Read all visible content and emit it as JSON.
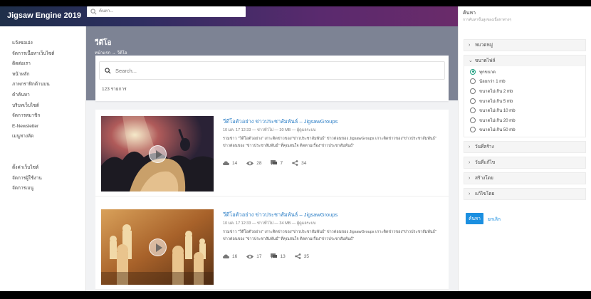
{
  "app": {
    "brand": "Jigsaw Engine 2019"
  },
  "topsearch": {
    "placeholder": "ค้นหา..."
  },
  "sidebar": {
    "section1": "",
    "items1": [
      "แจ้งขอเอ่ง",
      "จัดการเนื้อหาเว็บไซต์",
      "ติดต่อเรา",
      "หน้าหลัก",
      "ภาพกราฟิกด้านบน",
      "คำค้นหา",
      "บริบทเว็บไซต์",
      "จัดการสมาชิก",
      "E-Newsletter",
      "เมนูทางลัด"
    ],
    "section2": "",
    "items2": [
      "ตั้งค่าเว็บไซต์",
      "จัดการผู้ใช้งาน",
      "จัดการเมนู"
    ]
  },
  "header": {
    "title": "วีดีโอ",
    "breadcrumb": "หน้าแรก → วีดีโอ"
  },
  "search": {
    "placeholder": "Search...",
    "result_count": "123 รายการ"
  },
  "items": [
    {
      "title": "วีดีโอตัวอย่าง ข่าวประชาสัมพันธ์ – JigsawGroups",
      "meta": "10 มค. 17 12:33  —  ข่าวทั่วไป  —  30 MB  —  ผู้ดูแลระบบ",
      "desc": "รวมข่าว \"วีดีโอตัวอย่าง\" เกาะติดข่าวของ\"ข่าวประชาสัมพันธ์\" ข่าวต่อนของ JigsawGroups เกาะติดข่าวของ\"ข่าวประชาสัมพันธ์\" ข่าวต่อนของ \"ข่าวประชาสัมพันธ์\" ที่คุณสนใจ ติดตามเรื่อง\"ข่าวประชาสัมพันธ์\"",
      "views": "14",
      "eyes": "28",
      "comments": "7",
      "shares": "34"
    },
    {
      "title": "วีดีโอตัวอย่าง ข่าวประชาสัมพันธ์ – JigsawGroups",
      "meta": "10 มค. 17 12:33  —  ข่าวทั่วไป  —  34 MB  —  ผู้ดูแลระบบ",
      "desc": "รวมข่าว \"วีดีโอตัวอย่าง\" เกาะติดข่าวของ\"ข่าวประชาสัมพันธ์\" ข่าวต่อนของ JigsawGroups เกาะติดข่าวของ\"ข่าวประชาสัมพันธ์\" ข่าวต่อนของ \"ข่าวประชาสัมพันธ์\" ที่คุณสนใจ ติดตามเรื่อง\"ข่าวประชาสัมพันธ์\"",
      "views": "16",
      "eyes": "17",
      "comments": "13",
      "shares": "35"
    }
  ],
  "panel": {
    "title": "ค้นหา",
    "subtitle": "การค้นหาขั้นสูงของเนื้อหาต่างๆ",
    "filters": [
      {
        "label": "หมวดหมู่",
        "open": false
      },
      {
        "label": "ขนาดไฟล์",
        "open": true,
        "options": [
          "ทุกขนาด",
          "น้อยกว่า 1 mb",
          "ขนาดไม่เกิน 2 mb",
          "ขนาดไม่เกิน 5 mb",
          "ขนาดไม่เกิน 10 mb",
          "ขนาดไม่เกิน 20 mb",
          "ขนาดไม่เกิน 50 mb"
        ],
        "selected": 0
      },
      {
        "label": "วันที่สร้าง",
        "open": false
      },
      {
        "label": "วันที่แก้ไข",
        "open": false
      },
      {
        "label": "สร้างโดย",
        "open": false
      },
      {
        "label": "แก้ไขโดย",
        "open": false
      }
    ],
    "search_button": "ค้นหา",
    "cancel_link": "ยกเลิก"
  },
  "colors": {
    "accent": "#1b8fe0",
    "link": "#2f80c7",
    "radio": "#1a9e7e",
    "header": "#7d8394"
  }
}
